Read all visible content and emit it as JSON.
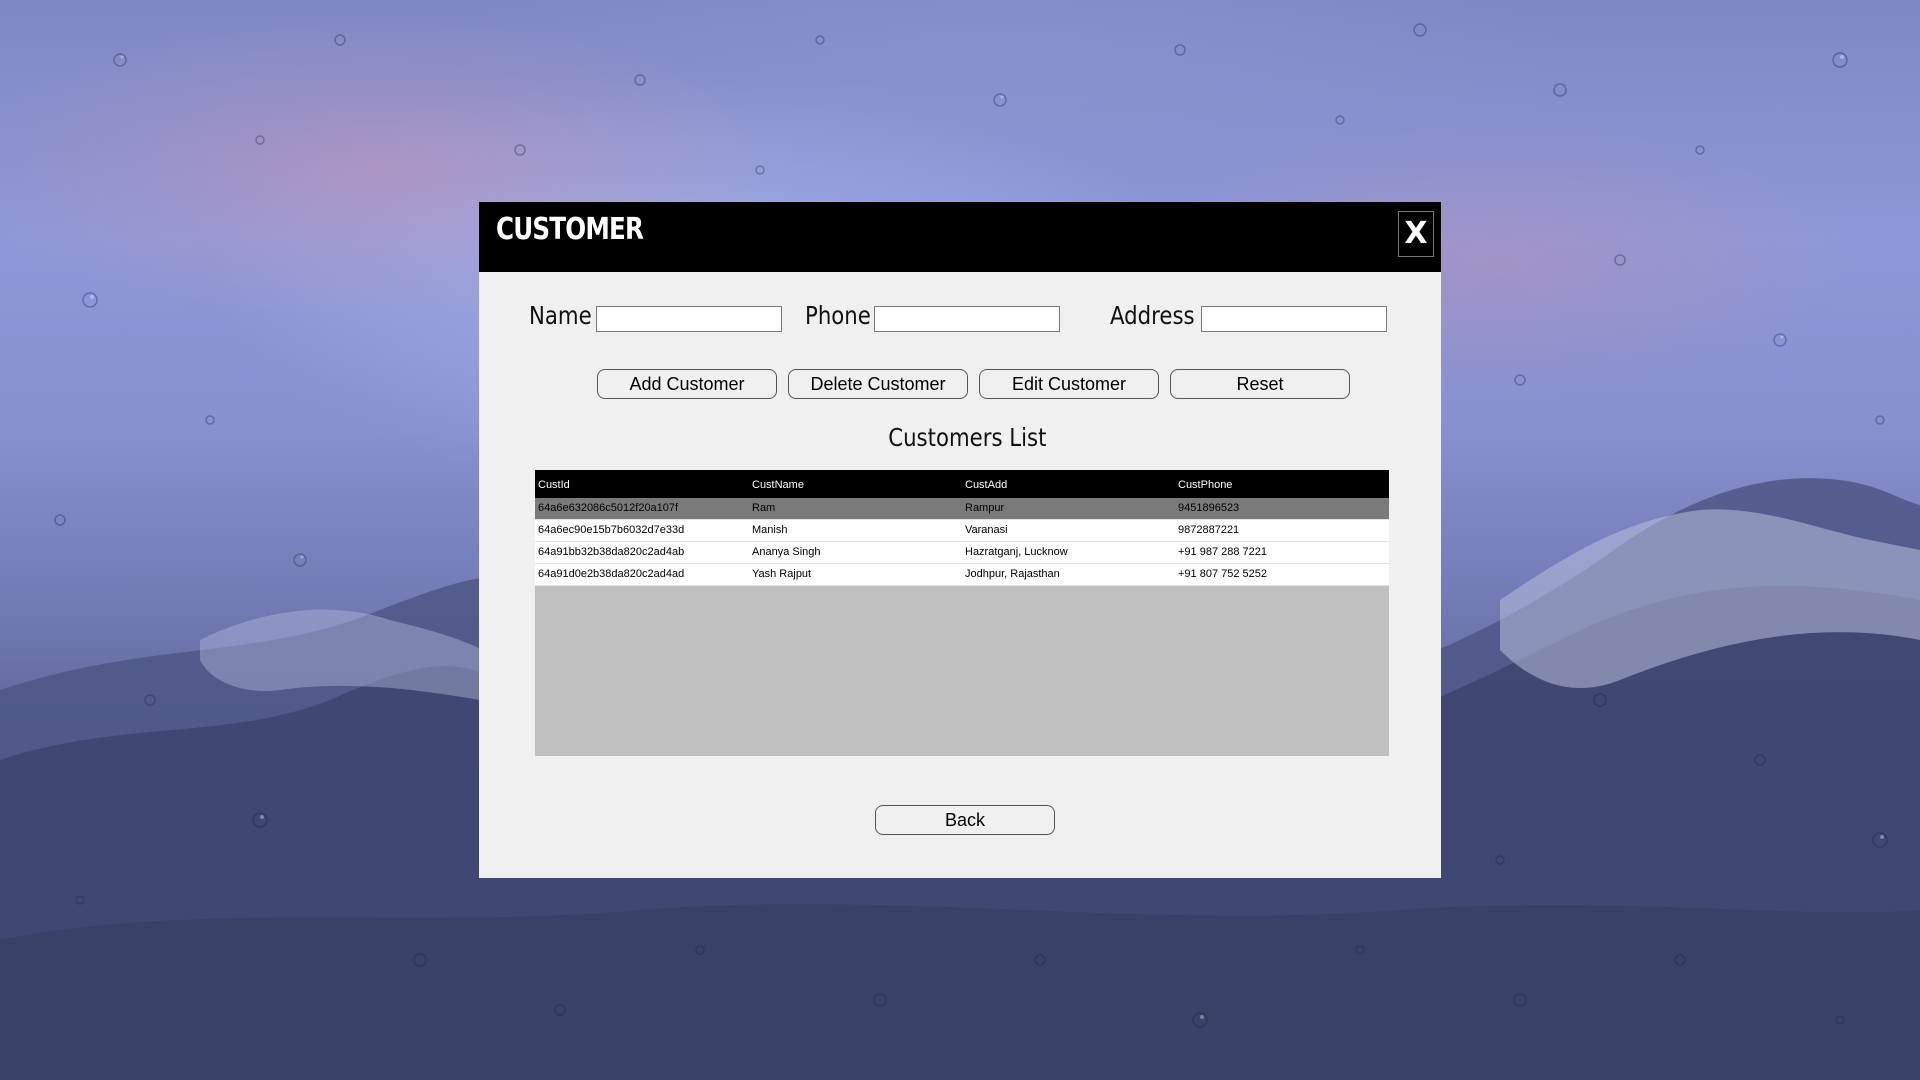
{
  "window": {
    "title": "CUSTOMER",
    "close_label": "X"
  },
  "form": {
    "name_label": "Name",
    "name_value": "",
    "phone_label": "Phone",
    "phone_value": "",
    "address_label": "Address",
    "address_value": ""
  },
  "actions": {
    "add": "Add Customer",
    "delete": "Delete Customer",
    "edit": "Edit Customer",
    "reset": "Reset",
    "back": "Back"
  },
  "list": {
    "title": "Customers List",
    "columns": [
      "CustId",
      "CustName",
      "CustAdd",
      "CustPhone"
    ],
    "rows": [
      {
        "id": "64a6e632086c5012f20a107f",
        "name": "Ram",
        "address": "Rampur",
        "phone": "9451896523",
        "selected": true
      },
      {
        "id": "64a6ec90e15b7b6032d7e33d",
        "name": "Manish",
        "address": "Varanasi",
        "phone": "9872887221",
        "selected": false
      },
      {
        "id": "64a91bb32b38da820c2ad4ab",
        "name": "Ananya Singh",
        "address": "Hazratganj, Lucknow",
        "phone": "+91 987 288 7221",
        "selected": false
      },
      {
        "id": "64a91d0e2b38da820c2ad4ad",
        "name": "Yash Rajput",
        "address": "Jodhpur, Rajasthan",
        "phone": "+91 807 752 5252",
        "selected": false
      }
    ]
  },
  "colors": {
    "titlebar": "#000000",
    "dialog_bg": "#f0f0f0",
    "grid_empty": "#c0c0c0",
    "selected_row": "#7a7a7a"
  }
}
